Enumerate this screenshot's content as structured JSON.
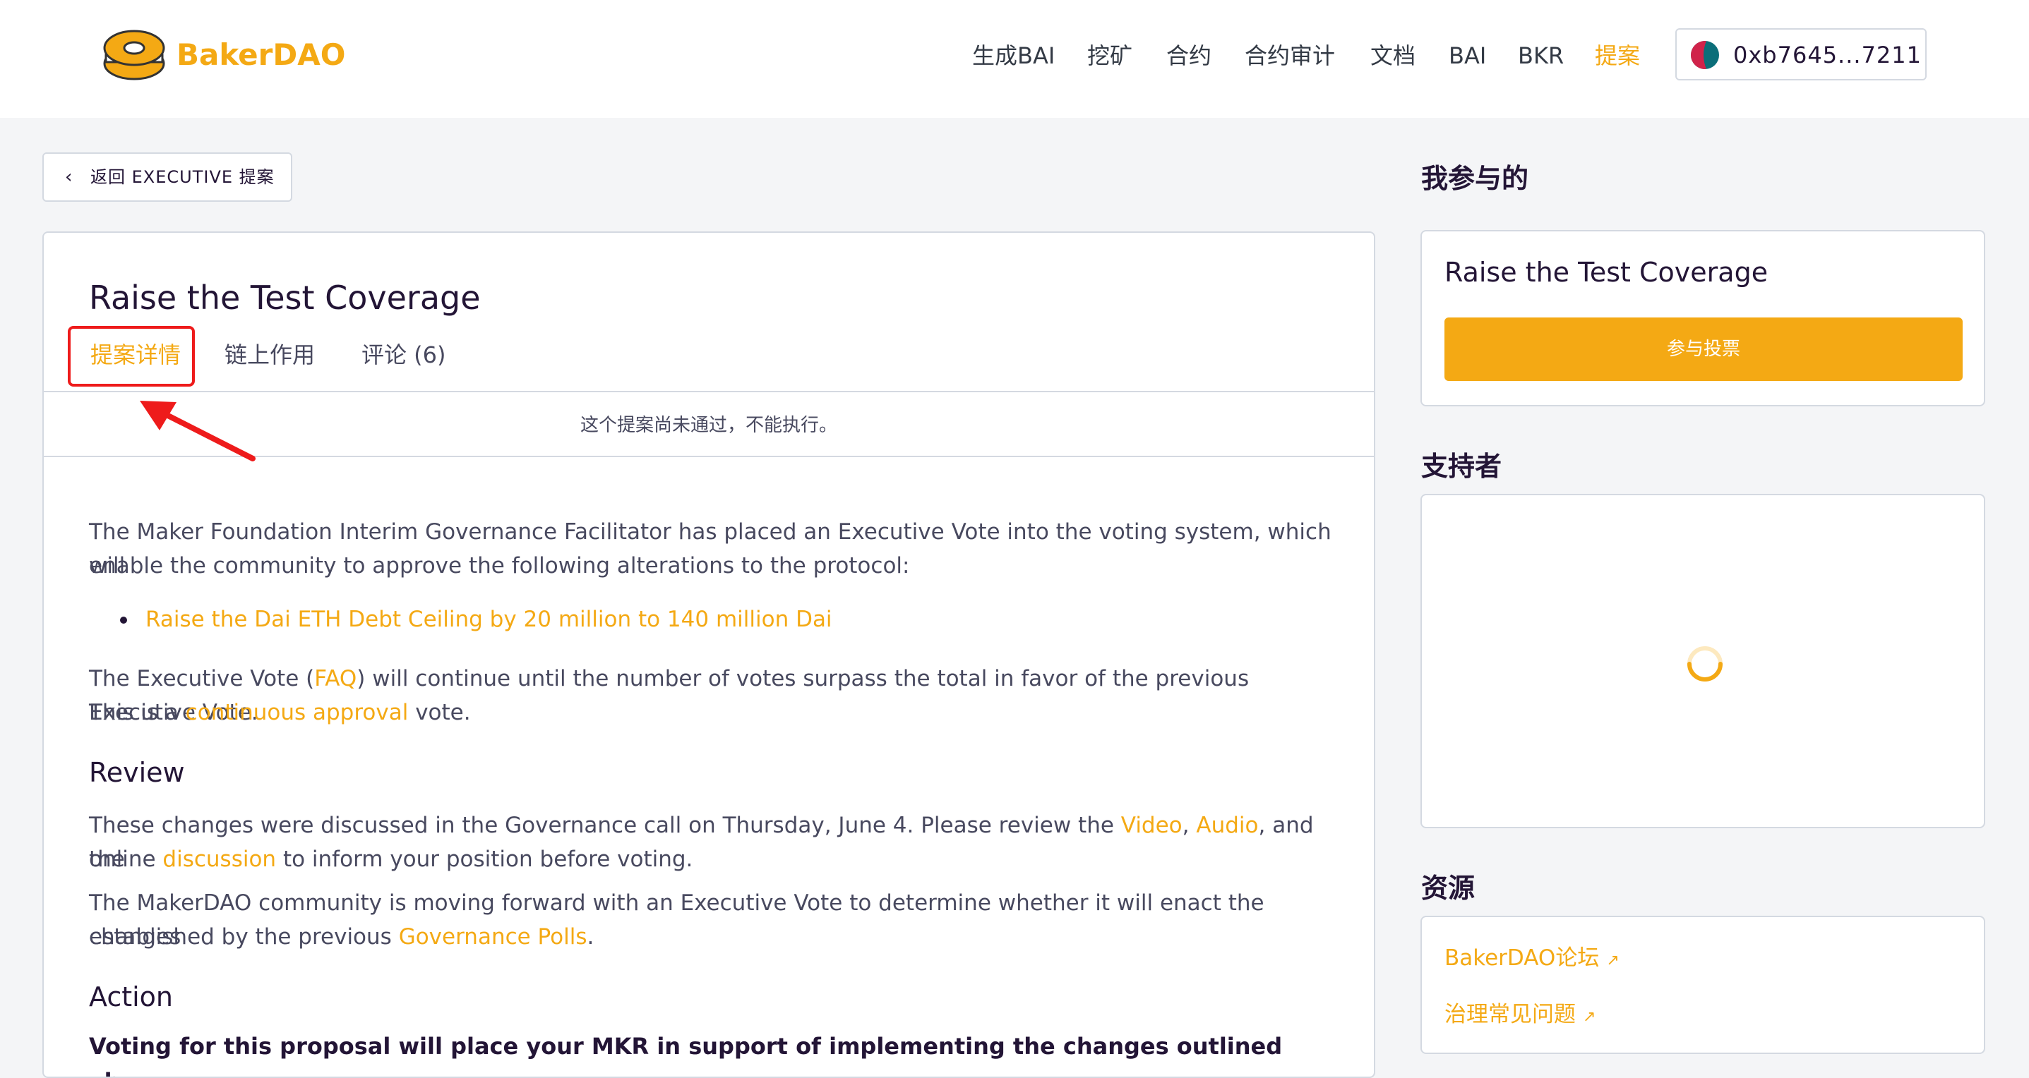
{
  "header": {
    "brand": "BakerDAO",
    "nav": [
      {
        "label": "生成BAI",
        "active": false
      },
      {
        "label": "挖矿",
        "active": false
      },
      {
        "label": "合约",
        "active": false
      },
      {
        "label": "合约审计",
        "active": false
      },
      {
        "label": "文档",
        "active": false
      },
      {
        "label": "BAI",
        "active": false
      },
      {
        "label": "BKR",
        "active": false
      },
      {
        "label": "提案",
        "active": true
      }
    ],
    "wallet_address": "0xb7645...7211"
  },
  "back_button": {
    "label": "返回 EXECUTIVE 提案"
  },
  "proposal": {
    "title": "Raise the Test Coverage",
    "tabs": [
      {
        "label": "提案详情",
        "active": true
      },
      {
        "label": "链上作用",
        "active": false
      },
      {
        "label": "评论 (6)",
        "active": false
      }
    ],
    "notice": "这个提案尚未通过，不能执行。",
    "intro_1": "The Maker Foundation Interim Governance Facilitator has placed an Executive Vote into the voting system, which will",
    "intro_2": "enable the community to approve the following alterations to the protocol:",
    "bullet": "Raise the Dai ETH Debt Ceiling by 20 million to 140 million Dai",
    "exec_1_pre": "The Executive Vote (",
    "exec_1_link": "FAQ",
    "exec_1_post": ") will continue until the number of votes surpass the total in favor of the previous Executive Vote.",
    "exec_2_pre": "This is a ",
    "exec_2_link": "continuous approval",
    "exec_2_post": " vote.",
    "review_heading": "Review",
    "review_1_pre": "These changes were discussed in the Governance call on Thursday, June 4. Please review the ",
    "review_1_link1": "Video",
    "review_1_sep": ", ",
    "review_1_link2": "Audio",
    "review_1_post": ", and the",
    "review_2_pre": "online ",
    "review_2_link": "discussion",
    "review_2_post": " to inform your position before voting.",
    "review_3": "The MakerDAO community is moving forward with an Executive Vote to determine whether it will enact the changes",
    "review_4_pre": "established by the previous ",
    "review_4_link": "Governance Polls",
    "review_4_post": ".",
    "action_heading": "Action",
    "action_text": "Voting for this proposal will place your MKR in support of implementing the changes outlined above."
  },
  "sidebar": {
    "participating_heading": "我参与的",
    "participating_title": "Raise the Test Coverage",
    "vote_button": "参与投票",
    "supporters_heading": "支持者",
    "resources_heading": "资源",
    "resources": [
      {
        "label": "BakerDAO论坛",
        "icon": "external-link-arrow"
      },
      {
        "label": "治理常见问题",
        "icon": "external-link-arrow"
      }
    ]
  },
  "colors": {
    "accent": "#f4a914",
    "highlight": "#ee1b1b",
    "text": "#231536",
    "muted": "#48495f"
  }
}
